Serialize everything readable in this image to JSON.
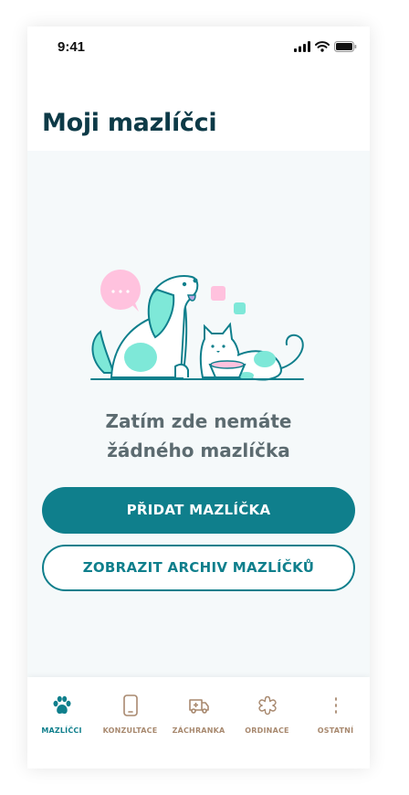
{
  "status_bar": {
    "time": "9:41"
  },
  "header": {
    "title": "Moji mazlíčci"
  },
  "empty_state": {
    "line1": "Zatím zde nemáte",
    "line2": "žádného mazlíčka"
  },
  "actions": {
    "add_pet": "PŘIDAT MAZLÍČKA",
    "show_archive": "ZOBRAZIT ARCHIV MAZLÍČKŮ"
  },
  "tabbar": {
    "items": [
      {
        "label": "MAZLÍČCI",
        "icon": "paw-icon",
        "active": true
      },
      {
        "label": "KONZULTACE",
        "icon": "phone-icon",
        "active": false
      },
      {
        "label": "ZÁCHRANKA",
        "icon": "ambulance-icon",
        "active": false
      },
      {
        "label": "ORDINACE",
        "icon": "clinic-icon",
        "active": false
      },
      {
        "label": "OSTATNÍ",
        "icon": "more-icon",
        "active": false
      }
    ]
  },
  "colors": {
    "primary": "#0f7f8c",
    "title": "#0d3a47",
    "text_muted": "#5c6b70",
    "tab_inactive": "#a8896f",
    "mint": "#7ee8d8",
    "pink": "#ffc2de"
  }
}
